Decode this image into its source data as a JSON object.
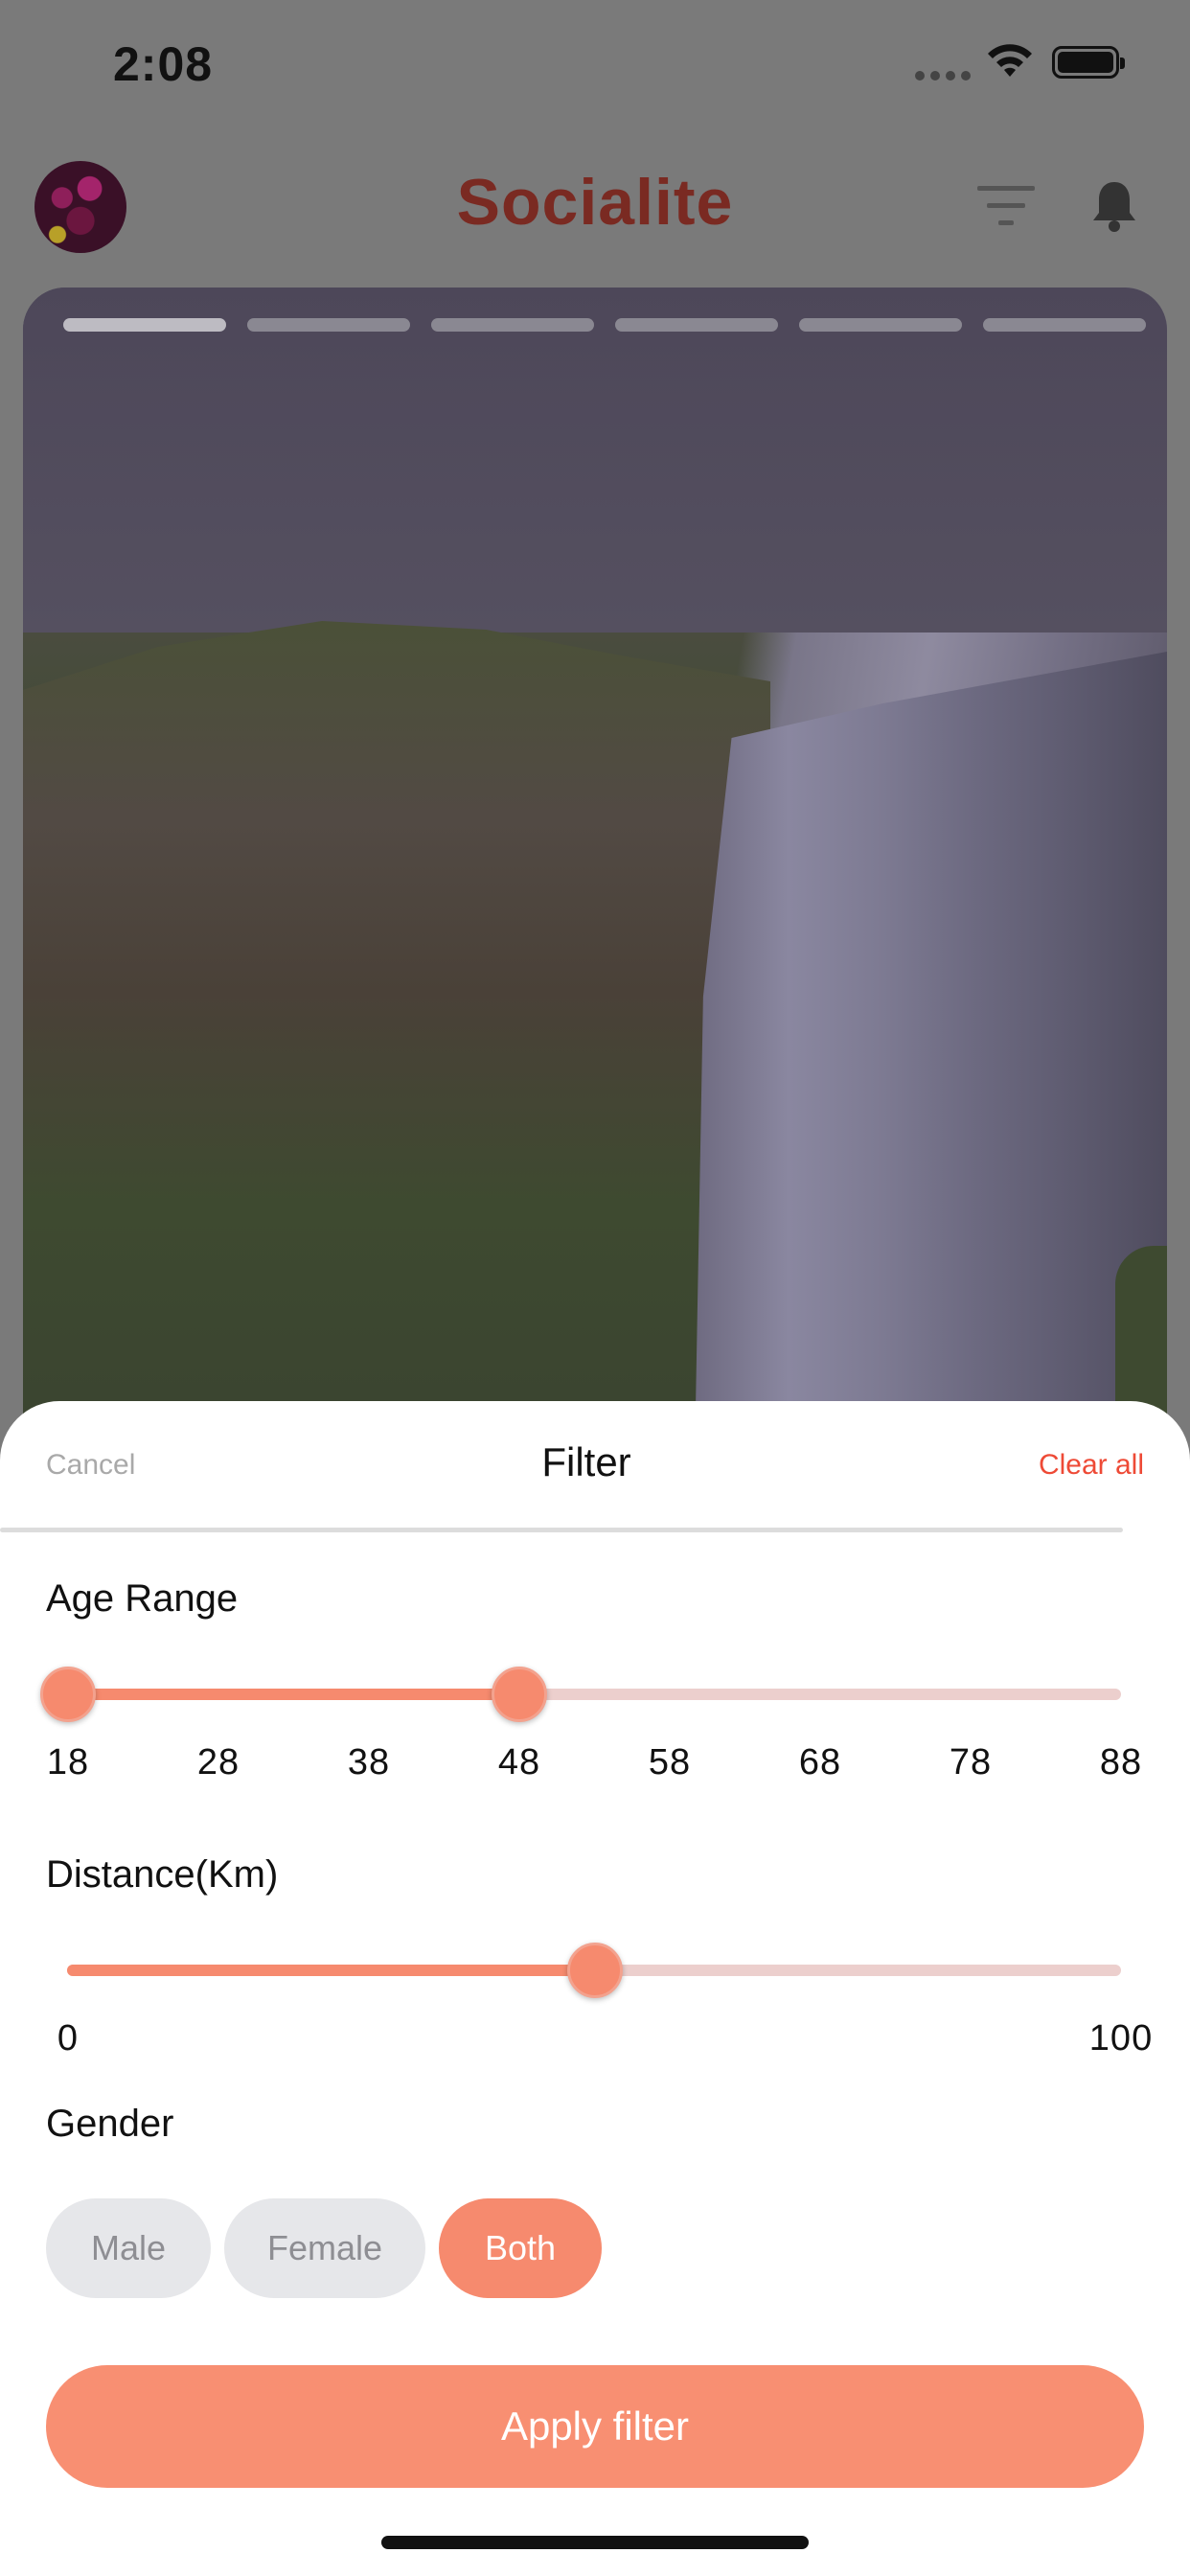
{
  "status_bar": {
    "time": "2:08"
  },
  "header": {
    "app_name": "Socialite",
    "brand_color": "#7a2a22"
  },
  "story": {
    "segments": 6
  },
  "filter_sheet": {
    "cancel_label": "Cancel",
    "title": "Filter",
    "clear_label": "Clear all",
    "age_range": {
      "label": "Age Range",
      "ticks": [
        "18",
        "28",
        "38",
        "48",
        "58",
        "68",
        "78",
        "88"
      ],
      "min_value": 18,
      "max_value": 48
    },
    "distance": {
      "label": "Distance(Km)",
      "min_label": "0",
      "max_label": "100",
      "value": 50
    },
    "gender": {
      "label": "Gender",
      "options": [
        "Male",
        "Female",
        "Both"
      ],
      "selected": "Both"
    },
    "apply_label": "Apply filter",
    "accent_color": "#f68a6e"
  }
}
